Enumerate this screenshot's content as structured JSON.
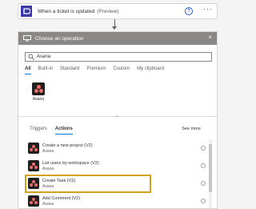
{
  "trigger": {
    "title": "When a ticket is updated",
    "preview": "(Preview)",
    "help_icon": "?",
    "more_icon": "···"
  },
  "panel": {
    "title": "Choose an operation",
    "close_icon": "×",
    "search": {
      "value": "Asana"
    },
    "filter_tabs": [
      "All",
      "Built-in",
      "Standard",
      "Premium",
      "Custom",
      "My clipboard"
    ],
    "active_filter": "All",
    "connector": {
      "label": "Asana"
    },
    "collapse_icon": "⌃"
  },
  "actions": {
    "tabs": [
      "Triggers",
      "Actions"
    ],
    "active_tab": "Actions",
    "see_more": "See more",
    "items": [
      {
        "title": "Create a new project (V2)",
        "subtitle": "Asana"
      },
      {
        "title": "List users by workspace (V2)",
        "subtitle": "Asana"
      },
      {
        "title": "Create Task (V2)",
        "subtitle": "Asana",
        "highlighted": true
      },
      {
        "title": "Add Comment (V2)",
        "subtitle": "Asana"
      }
    ]
  },
  "colors": {
    "header_bg": "#8a8886",
    "accent": "#0078d4",
    "asana_dot": "#f06a6a",
    "highlight_border": "#d4a017",
    "trigger_icon_bg": "#3a3aa8"
  }
}
